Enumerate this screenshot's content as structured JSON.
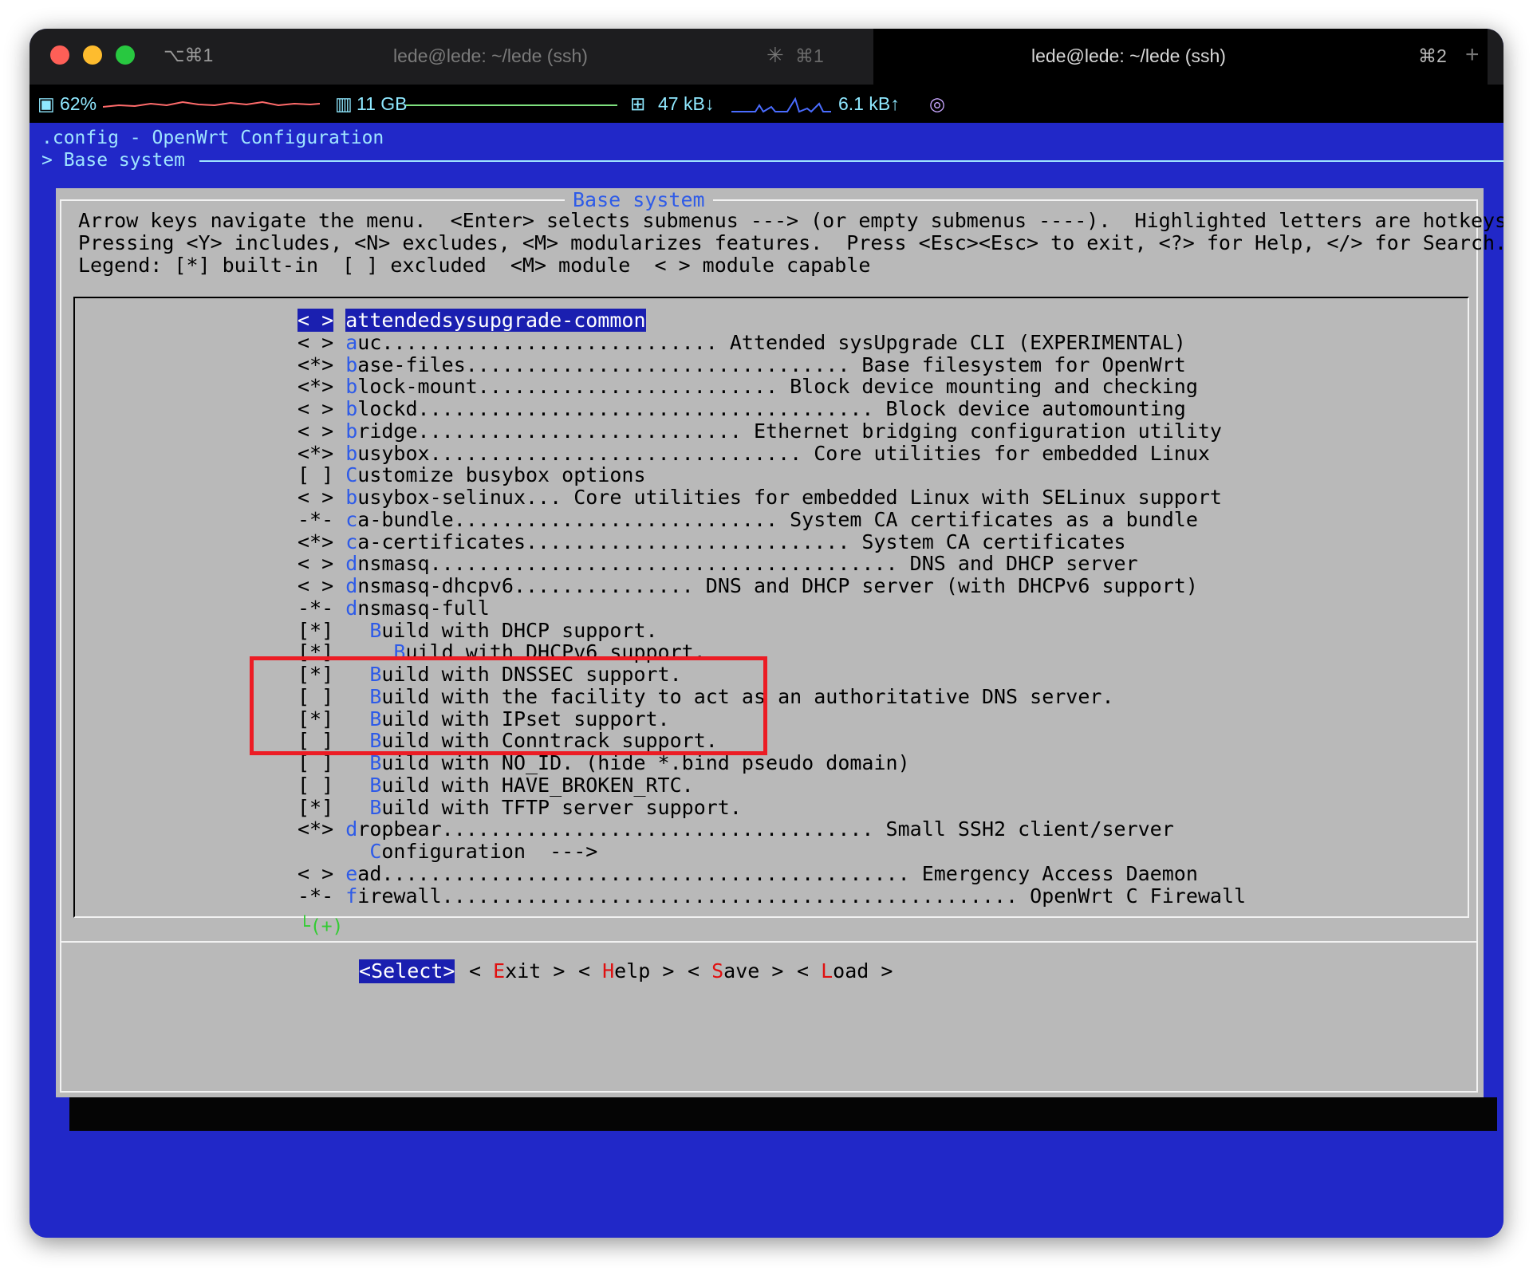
{
  "window": {
    "keys": "⌥⌘1",
    "tabs": [
      {
        "title": "lede@lede: ~/lede (ssh)",
        "shortcut": "⌘1"
      },
      {
        "title": "lede@lede: ~/lede (ssh)",
        "shortcut": "⌘2"
      }
    ],
    "new_tab": "+"
  },
  "status": {
    "cpu": "62%",
    "mem": "11 GB",
    "net_down": "47 kB↓",
    "net_up": "6.1 kB↑"
  },
  "terminal": {
    "config_title": ".config - OpenWrt Configuration",
    "breadcrumb": "> Base system",
    "dialog_title": "Base system",
    "help_lines": [
      "Arrow keys navigate the menu.  <Enter> selects submenus ---> (or empty submenus ----).  Highlighted letters are hotkeys.",
      "Pressing <Y> includes, <N> excludes, <M> modularizes features.  Press <Esc><Esc> to exit, <?> for Help, </> for Search.",
      "Legend: [*] built-in  [ ] excluded  <M> module  < > module capable"
    ],
    "menu": [
      {
        "state": "< >",
        "indent": " ",
        "hot": "a",
        "rest": "ttendedsysupgrade-common",
        "selected": true
      },
      {
        "state": "< >",
        "indent": " ",
        "hot": "a",
        "rest": "uc............................ Attended sysUpgrade CLI (EXPERIMENTAL)"
      },
      {
        "state": "<*>",
        "indent": " ",
        "hot": "b",
        "rest": "ase-files................................ Base filesystem for OpenWrt"
      },
      {
        "state": "<*>",
        "indent": " ",
        "hot": "b",
        "rest": "lock-mount......................... Block device mounting and checking"
      },
      {
        "state": "< >",
        "indent": " ",
        "hot": "b",
        "rest": "lockd...................................... Block device automounting"
      },
      {
        "state": "< >",
        "indent": " ",
        "hot": "b",
        "rest": "ridge........................... Ethernet bridging configuration utility"
      },
      {
        "state": "<*>",
        "indent": " ",
        "hot": "b",
        "rest": "usybox............................... Core utilities for embedded Linux"
      },
      {
        "state": "[ ]",
        "indent": " ",
        "hot": "C",
        "rest": "ustomize busybox options"
      },
      {
        "state": "< >",
        "indent": " ",
        "hot": "b",
        "rest": "usybox-selinux... Core utilities for embedded Linux with SELinux support"
      },
      {
        "state": "-*-",
        "indent": " ",
        "hot": "c",
        "rest": "a-bundle........................... System CA certificates as a bundle"
      },
      {
        "state": "<*>",
        "indent": " ",
        "hot": "c",
        "rest": "a-certificates........................... System CA certificates"
      },
      {
        "state": "< >",
        "indent": " ",
        "hot": "d",
        "rest": "nsmasq....................................... DNS and DHCP server"
      },
      {
        "state": "< >",
        "indent": " ",
        "hot": "d",
        "rest": "nsmasq-dhcpv6............... DNS and DHCP server (with DHCPv6 support)"
      },
      {
        "state": "-*-",
        "indent": " ",
        "hot": "d",
        "rest": "nsmasq-full"
      },
      {
        "state": "[*]",
        "indent": "   ",
        "hot": "B",
        "rest": "uild with DHCP support."
      },
      {
        "state": "[*]",
        "indent": "     ",
        "hot": "B",
        "rest": "uild with DHCPv6 support."
      },
      {
        "state": "[*]",
        "indent": "   ",
        "hot": "B",
        "rest": "uild with DNSSEC support."
      },
      {
        "state": "[ ]",
        "indent": "   ",
        "hot": "B",
        "rest": "uild with the facility to act as an authoritative DNS server."
      },
      {
        "state": "[*]",
        "indent": "   ",
        "hot": "B",
        "rest": "uild with IPset support."
      },
      {
        "state": "[ ]",
        "indent": "   ",
        "hot": "B",
        "rest": "uild with Conntrack support."
      },
      {
        "state": "[ ]",
        "indent": "   ",
        "hot": "B",
        "rest": "uild with NO_ID. (hide *.bind pseudo domain)"
      },
      {
        "state": "[ ]",
        "indent": "   ",
        "hot": "B",
        "rest": "uild with HAVE_BROKEN_RTC."
      },
      {
        "state": "[*]",
        "indent": "   ",
        "hot": "B",
        "rest": "uild with TFTP server support."
      },
      {
        "state": "<*>",
        "indent": " ",
        "hot": "d",
        "rest": "ropbear.................................... Small SSH2 client/server"
      },
      {
        "state": "   ",
        "indent": "   ",
        "hot": "C",
        "rest": "onfiguration  --->"
      },
      {
        "state": "< >",
        "indent": " ",
        "hot": "e",
        "rest": "ad............................................ Emergency Access Daemon"
      },
      {
        "state": "-*-",
        "indent": " ",
        "hot": "f",
        "rest": "irewall................................................ OpenWrt C Firewall"
      }
    ],
    "more_indicator": "└(+)",
    "buttons": [
      {
        "pre": "<",
        "hot": "S",
        "rest": "elect>",
        "active": true
      },
      {
        "pre": "< ",
        "hot": "E",
        "rest": "xit >",
        "active": false
      },
      {
        "pre": "< ",
        "hot": "H",
        "rest": "elp >",
        "active": false
      },
      {
        "pre": "< ",
        "hot": "S",
        "rest": "ave >",
        "active": false
      },
      {
        "pre": "< ",
        "hot": "L",
        "rest": "oad >",
        "active": false
      }
    ]
  },
  "colors": {
    "terminal_bg": "#2128c8",
    "dialog_bg": "#b9b9b9",
    "hotkey": "#2e5be8",
    "button_hotkey": "#e01010",
    "highlight": "#1a1fb0",
    "annotation": "#ec1c24"
  }
}
